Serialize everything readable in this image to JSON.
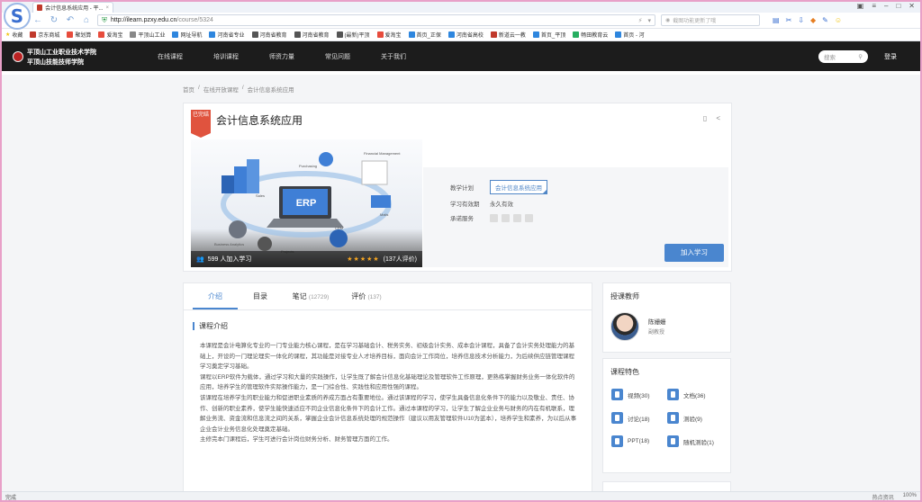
{
  "browser": {
    "tab_title": "会计信息系统应用 - 平...",
    "url_host": "http://ilearn.pzxy.edu.cn",
    "url_path": "/course/5324",
    "search_placeholder": "截图功能更新了哦",
    "bookmarks_label": "收藏",
    "bookmarks": [
      {
        "label": "京东商城",
        "color": "#c0392b"
      },
      {
        "label": "聚划算",
        "color": "#e74c3c"
      },
      {
        "label": "爱淘宝",
        "color": "#e74c3c"
      },
      {
        "label": "平顶山工业",
        "color": "#888888"
      },
      {
        "label": "网址导航",
        "color": "#2e86de"
      },
      {
        "label": "河南省专业",
        "color": "#2e86de"
      },
      {
        "label": "河南省教育",
        "color": "#555555"
      },
      {
        "label": "河南省教育",
        "color": "#555555"
      },
      {
        "label": "(最新)平顶",
        "color": "#555555"
      },
      {
        "label": "爱淘宝",
        "color": "#e74c3c"
      },
      {
        "label": "首页_正保",
        "color": "#2e86de"
      },
      {
        "label": "河南省高校",
        "color": "#2e86de"
      },
      {
        "label": "新道云一教",
        "color": "#c0392b"
      },
      {
        "label": "首页_平顶",
        "color": "#2e86de"
      },
      {
        "label": "畅田教育云",
        "color": "#27ae60"
      },
      {
        "label": "首页 - 河",
        "color": "#2e86de"
      }
    ],
    "status_left": "完成",
    "status_right": [
      "热点资讯",
      "100%"
    ]
  },
  "site": {
    "school_name_1": "平顶山工业职业技术学院",
    "school_name_2": "平顶山技能技师学院",
    "nav": [
      "在线课程",
      "培训课程",
      "师资力量",
      "常见问题",
      "关于我们"
    ],
    "search_label": "搜索",
    "login_label": "登录"
  },
  "breadcrumb": [
    "首页",
    "/",
    "在线开放课程",
    "/",
    "会计信息系统应用"
  ],
  "course": {
    "status_badge": "已完结",
    "title": "会计信息系统应用",
    "students": "599 人加入学习",
    "rating_stars": "★★★★★",
    "reviews": "(137人评价)",
    "plan_label": "教学计划",
    "plan_value": "会计信息系统应用",
    "validity_label": "学习有效期",
    "validity_value": "永久有效",
    "share_label": "承诺服务",
    "join_button": "加入学习",
    "hero_labels": [
      "Purchasing",
      "Financial Management",
      "Sales",
      "ERP",
      "Mails",
      "Business Analytics",
      "Projects",
      "CRM"
    ]
  },
  "detail_tabs": [
    {
      "label": "介绍",
      "count": ""
    },
    {
      "label": "目录",
      "count": ""
    },
    {
      "label": "笔记",
      "count": "(12729)"
    },
    {
      "label": "评价",
      "count": "(137)"
    }
  ],
  "intro": {
    "section_title": "课程介绍",
    "paragraphs": [
      "本课程是会计电算化专业的一门专业能力核心课程，是在学习基础会计、税务实务、初级会计实务、成本会计课程，具备了会计实务处理能力的基础上，开设的一门理论理实一体化的课程，其功能是对接专业人才培养目标，面向会计工作岗位，培养信息技术分析能力，为后续供应链管理课程学习奠定学习基础。",
      "课程以ERP软件为载体，通过学习和大量的实践操作，让学生既了解会计信息化基础理论及管理软件工作原理，更熟练掌握财务业务一体化软件的应用，培养学生的管理软件实际操作能力，是一门综合性、实践性和应用性强的课程。",
      "该课程在培养学生的职业能力和促进职业素质的养成方面占有重要地位。通过该课程的学习，使学生具备信息化条件下的能力以及敬业、责任、协作、创新的职业素养，使学生能快速适应不同企业信息化条件下的会计工作。通过本课程的学习，让学生了解企业业务与财务的内在有机联系，理解业务流、资金流和信息流之间的关系，掌握企业会计信息系统处理的规范操作（建议以用友管理软件U10为蓝本），培养学生和素养，为以后从事企业会计业务信息化处理奠定基础。",
      "主修完本门课程后，学生可进行会计岗位财务分析、财务管理方面的工作。"
    ]
  },
  "teacher": {
    "box_title": "授课教师",
    "name": "陈姗姗",
    "role": "副教授"
  },
  "features": {
    "box_title": "课程特色",
    "items": [
      "视频(30)",
      "文档(36)",
      "讨论(18)",
      "测验(9)",
      "PPT(18)",
      "随机测验(1)"
    ]
  }
}
